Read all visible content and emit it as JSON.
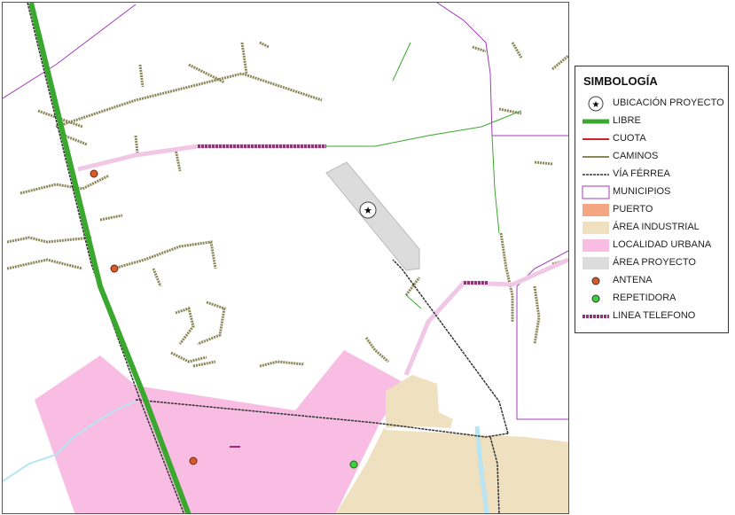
{
  "legend": {
    "title": "SIMBOLOGÍA",
    "items": [
      {
        "key": "ubicacion",
        "label": "UBICACIÓN PROYECTO",
        "icon": "star-circle-icon",
        "color": "#000000"
      },
      {
        "key": "libre",
        "label": "LIBRE",
        "icon": "thick-line",
        "color": "#3aa72f"
      },
      {
        "key": "cuota",
        "label": "CUOTA",
        "icon": "line",
        "color": "#d0202a"
      },
      {
        "key": "caminos",
        "label": "CAMINOS",
        "icon": "line",
        "color": "#8a8657"
      },
      {
        "key": "via",
        "label": "VÍA FÉRREA",
        "icon": "railway-line",
        "color": "#333333"
      },
      {
        "key": "municipios",
        "label": "MUNICIPIOS",
        "icon": "outline-box",
        "color": "#a13cb5"
      },
      {
        "key": "puerto",
        "label": "PUERTO",
        "icon": "filled-box",
        "color": "#f4a582"
      },
      {
        "key": "industrial",
        "label": "ÁREA INDUSTRIAL",
        "icon": "filled-box",
        "color": "#efe0c0"
      },
      {
        "key": "urbana",
        "label": "LOCALIDAD URBANA",
        "icon": "filled-box",
        "color": "#f9bde3"
      },
      {
        "key": "proyecto",
        "label": "ÁREA PROYECTO",
        "icon": "filled-box",
        "color": "#dcdcdc"
      },
      {
        "key": "antena",
        "label": "ANTENA",
        "icon": "antenna-dot-icon",
        "color": "#d9592a"
      },
      {
        "key": "repetidora",
        "label": "REPETIDORA",
        "icon": "repeater-dot-icon",
        "color": "#39d23a"
      },
      {
        "key": "telefono",
        "label": "LINEA TELEFONO",
        "icon": "dashed-thick-line",
        "color": "#a0287f"
      }
    ]
  },
  "colors": {
    "water": "#b8e4f4",
    "telefono_casing": "#f0c8e6"
  }
}
